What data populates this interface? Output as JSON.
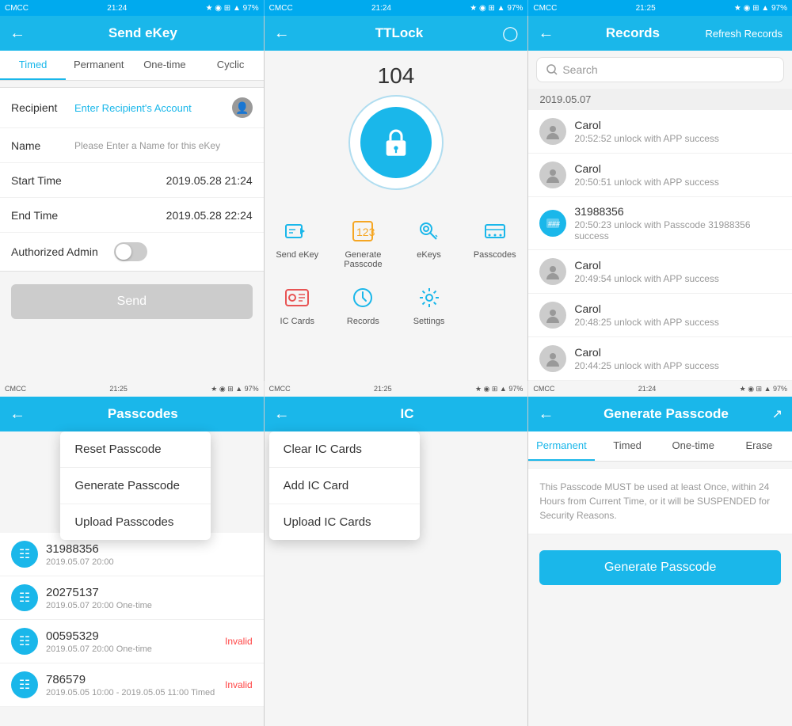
{
  "statusBar": {
    "left": {
      "carrier": "CMCC",
      "time": "21:24",
      "icons": "★ ◉ ⊞ ▲ 97%",
      "battery": "▓"
    },
    "center": {
      "carrier": "CMCC",
      "time": "21:24",
      "icons": "★ ◉ ⊞ ▲ 97%",
      "battery": "▓"
    },
    "right": {
      "carrier": "CMCC",
      "time": "21:25",
      "icons": "★ ◉ ⊞ ▲ 97%",
      "battery": "▓"
    }
  },
  "bottomStatusBar": {
    "left": {
      "carrier": "CMCC",
      "time": "21:25",
      "icons": "★ ◉ ⊞ ▲ 97%"
    },
    "center": {
      "carrier": "CMCC",
      "time": "21:25",
      "icons": "★ ◉ ⊞ ▲ 97%"
    },
    "right": {
      "carrier": "CMCC",
      "time": "21:24",
      "icons": "★ ◉ ⊞ ▲ 97%"
    }
  },
  "panel1": {
    "title": "Send eKey",
    "tabs": [
      "Timed",
      "Permanent",
      "One-time",
      "Cyclic"
    ],
    "activeTab": 0,
    "form": {
      "recipientLabel": "Recipient",
      "recipientPlaceholder": "Enter Recipient's Account",
      "nameLabel": "Name",
      "namePlaceholder": "Please Enter a Name for this eKey",
      "startTimeLabel": "Start Time",
      "startTimeValue": "2019.05.28 21:24",
      "endTimeLabel": "End Time",
      "endTimeValue": "2019.05.28 22:24",
      "authorizedAdminLabel": "Authorized Admin"
    },
    "sendButton": "Send"
  },
  "panel2": {
    "title": "TTLock",
    "lockNumber": "104",
    "menuItems": [
      {
        "label": "Send eKey",
        "icon": "send-ekey"
      },
      {
        "label": "Generate Passcode",
        "icon": "generate-passcode"
      },
      {
        "label": "eKeys",
        "icon": "ekeys"
      },
      {
        "label": "Passcodes",
        "icon": "passcodes"
      },
      {
        "label": "IC Cards",
        "icon": "ic-cards"
      },
      {
        "label": "Records",
        "icon": "records"
      },
      {
        "label": "Settings",
        "icon": "settings"
      }
    ]
  },
  "panel3": {
    "title": "Records",
    "refreshButton": "Refresh Records",
    "searchPlaceholder": "Search",
    "dateGroup": "2019.05.07",
    "records": [
      {
        "name": "Carol",
        "time": "20:52:52 unlock with APP success",
        "type": "person"
      },
      {
        "name": "Carol",
        "time": "20:50:51 unlock with APP success",
        "type": "person"
      },
      {
        "name": "31988356",
        "time": "20:50:23 unlock with Passcode 31988356 success",
        "type": "passcode"
      },
      {
        "name": "Carol",
        "time": "20:49:54 unlock with APP success",
        "type": "person"
      },
      {
        "name": "Carol",
        "time": "20:48:25 unlock with APP success",
        "type": "person"
      },
      {
        "name": "Carol",
        "time": "20:44:25 unlock with APP success",
        "type": "person"
      }
    ]
  },
  "panel4": {
    "title": "Passcodes",
    "contextMenu": {
      "items": [
        "Reset Passcode",
        "Generate Passcode",
        "Upload Passcodes"
      ]
    },
    "passcodes": [
      {
        "number": "31988356",
        "meta": "2019.05.07 20:00",
        "status": "",
        "type": ""
      },
      {
        "number": "20275137",
        "meta": "2019.05.07 20:00 One-time",
        "status": "",
        "type": "one-time"
      },
      {
        "number": "00595329",
        "meta": "2019.05.07 20:00 One-time",
        "status": "Invalid",
        "type": "one-time"
      },
      {
        "number": "786579",
        "meta": "2019.05.05 10:00 - 2019.05.05 11:00 Timed",
        "status": "Invalid",
        "type": "timed"
      }
    ]
  },
  "panel5": {
    "title": "IC",
    "contextMenu": {
      "items": [
        "Clear IC Cards",
        "Add IC Card",
        "Upload IC Cards"
      ]
    }
  },
  "panel6": {
    "title": "Generate Passcode",
    "tabs": [
      "Permanent",
      "Timed",
      "One-time",
      "Erase"
    ],
    "activeTab": 0,
    "notice": "This Passcode MUST be used at least Once, within 24 Hours from Current Time, or it will be SUSPENDED for Security Reasons.",
    "generateButton": "Generate Passcode"
  }
}
